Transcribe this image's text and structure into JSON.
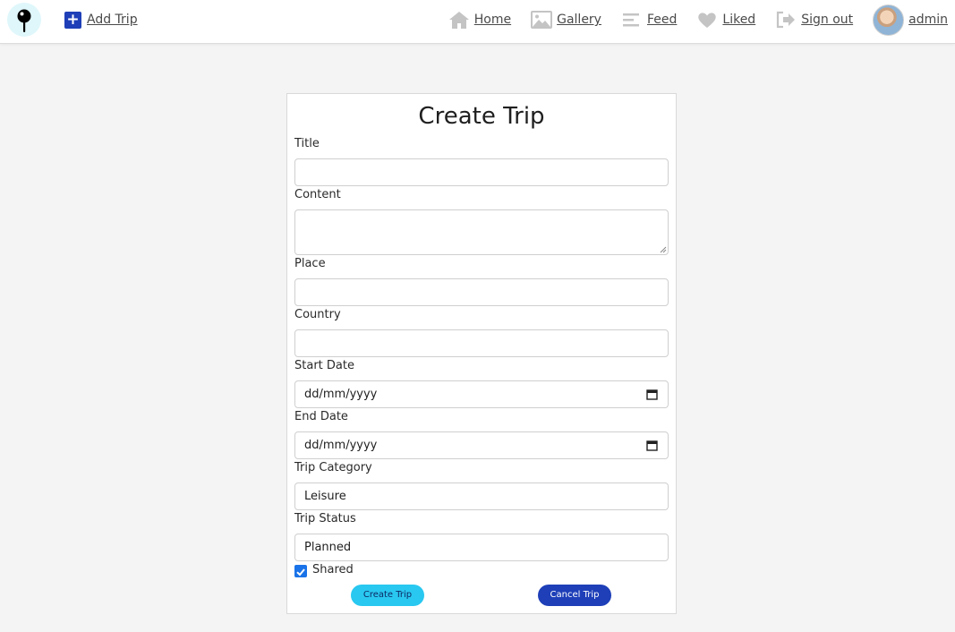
{
  "nav": {
    "add_trip": "Add Trip",
    "links": [
      {
        "label": "Home",
        "icon": "home-icon"
      },
      {
        "label": "Gallery",
        "icon": "gallery-icon"
      },
      {
        "label": "Feed",
        "icon": "feed-icon"
      },
      {
        "label": "Liked",
        "icon": "heart-icon"
      },
      {
        "label": "Sign out",
        "icon": "sign-out-icon"
      }
    ],
    "user": "admin"
  },
  "form": {
    "title": "Create Trip",
    "fields": {
      "title": {
        "label": "Title",
        "value": ""
      },
      "content": {
        "label": "Content",
        "value": ""
      },
      "place": {
        "label": "Place",
        "value": ""
      },
      "country": {
        "label": "Country",
        "value": ""
      },
      "start_date": {
        "label": "Start Date",
        "placeholder": "dd/mm/yyyy"
      },
      "end_date": {
        "label": "End Date",
        "placeholder": "dd/mm/yyyy"
      },
      "category": {
        "label": "Trip Category",
        "value": "Leisure"
      },
      "status": {
        "label": "Trip Status",
        "value": "Planned"
      }
    },
    "shared": {
      "label": "Shared",
      "checked": true
    },
    "create_label": "Create Trip",
    "cancel_label": "Cancel Trip"
  },
  "colors": {
    "primary": "#1e3fb8",
    "accent": "#29c8f0",
    "checkbox": "#1a73e8"
  }
}
